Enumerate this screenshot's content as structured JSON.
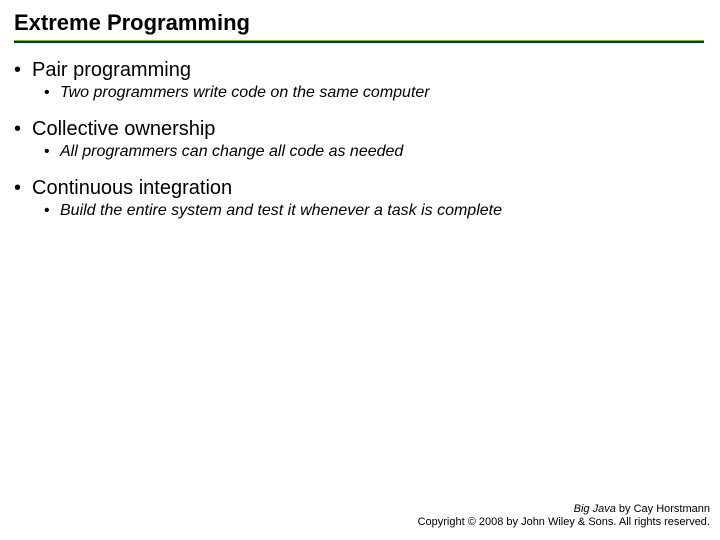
{
  "title": "Extreme Programming",
  "items": [
    {
      "heading": "Pair programming",
      "sub": "Two programmers write code on the same computer"
    },
    {
      "heading": "Collective ownership",
      "sub": "All programmers can change all code as needed"
    },
    {
      "heading": "Continuous integration",
      "sub": "Build the entire system and test it whenever a task is complete"
    }
  ],
  "footer": {
    "book": "Big Java",
    "byline": " by Cay Horstmann",
    "copyright": "Copyright © 2008 by John Wiley & Sons. All rights reserved."
  }
}
